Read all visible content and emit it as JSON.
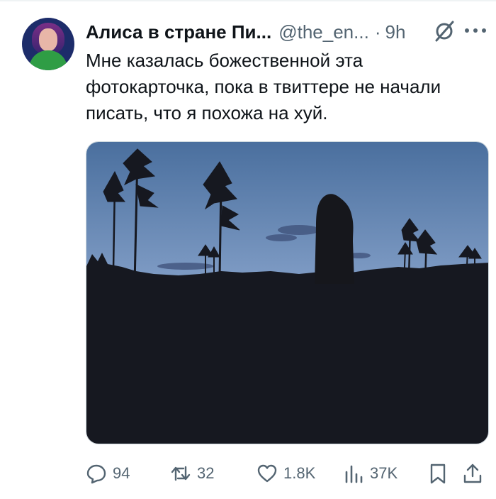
{
  "tweet": {
    "display_name": "Алиса в стране Пи...",
    "handle": "@the_en...",
    "separator": "·",
    "time": "9h",
    "text": "Мне казалась божественной эта\nфотокарточка, пока в твиттере не начали\nписать, что я похожа на хуй."
  },
  "media": {
    "sky_colors": [
      "#4a6f9e",
      "#7e9bc4",
      "#c9b4c8"
    ],
    "ground_color": "#161820"
  },
  "actions": {
    "replies": "94",
    "reposts": "32",
    "likes": "1.8K",
    "views": "37K"
  },
  "icons": [
    "reply-icon",
    "repost-icon",
    "like-icon",
    "views-icon",
    "bookmark-icon",
    "share-icon",
    "grok-icon",
    "more-icon"
  ]
}
